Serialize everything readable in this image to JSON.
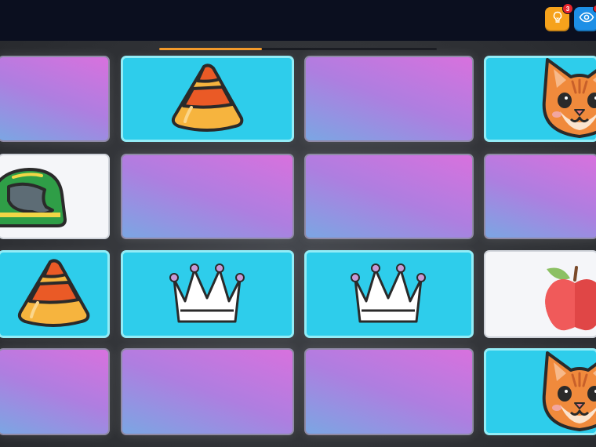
{
  "hud": {
    "hint_badge": "3",
    "hint_icon": "lightbulb-icon",
    "reveal_icon": "eye-icon",
    "reveal_badge": ""
  },
  "progress": {
    "value": 0.37
  },
  "colors": {
    "topbar": "#0b0f1f",
    "hint": "#f6a21c",
    "reveal": "#1d8fe6",
    "progress": "#f39a2b",
    "card_face": "#2ecdeb",
    "card_back_start": "#d871de",
    "card_back_end": "#7ba6e3"
  },
  "board": {
    "rows": 4,
    "columns": 4,
    "cards": [
      {
        "row": 0,
        "col": 0,
        "state": "hidden",
        "icon": ""
      },
      {
        "row": 0,
        "col": 1,
        "state": "revealed",
        "icon": "candy-corn"
      },
      {
        "row": 0,
        "col": 2,
        "state": "hidden",
        "icon": ""
      },
      {
        "row": 0,
        "col": 3,
        "state": "revealed",
        "icon": "cat"
      },
      {
        "row": 1,
        "col": 0,
        "state": "matched",
        "icon": "helmet"
      },
      {
        "row": 1,
        "col": 1,
        "state": "hidden",
        "icon": ""
      },
      {
        "row": 1,
        "col": 2,
        "state": "hidden",
        "icon": ""
      },
      {
        "row": 1,
        "col": 3,
        "state": "hidden",
        "icon": ""
      },
      {
        "row": 2,
        "col": 0,
        "state": "revealed",
        "icon": "candy-corn"
      },
      {
        "row": 2,
        "col": 1,
        "state": "revealed",
        "icon": "crown"
      },
      {
        "row": 2,
        "col": 2,
        "state": "revealed",
        "icon": "crown"
      },
      {
        "row": 2,
        "col": 3,
        "state": "matched",
        "icon": "apple"
      },
      {
        "row": 3,
        "col": 0,
        "state": "hidden",
        "icon": ""
      },
      {
        "row": 3,
        "col": 1,
        "state": "hidden",
        "icon": ""
      },
      {
        "row": 3,
        "col": 2,
        "state": "hidden",
        "icon": ""
      },
      {
        "row": 3,
        "col": 3,
        "state": "revealed",
        "icon": "cat"
      }
    ]
  }
}
